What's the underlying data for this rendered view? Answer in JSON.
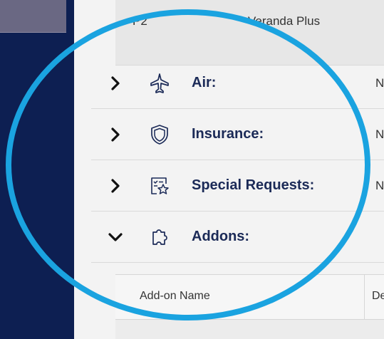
{
  "cabin": {
    "code": "P2",
    "name": "Veranda Plus"
  },
  "sections": [
    {
      "label": "Air:",
      "value": "N",
      "expanded": false,
      "icon": "airplane-icon"
    },
    {
      "label": "Insurance:",
      "value": "N",
      "expanded": false,
      "icon": "shield-icon"
    },
    {
      "label": "Special Requests:",
      "value": "N",
      "expanded": false,
      "icon": "special-request-icon"
    },
    {
      "label": "Addons:",
      "value": "",
      "expanded": true,
      "icon": "puzzle-icon"
    }
  ],
  "addons_table": {
    "columns": [
      "Add-on Name",
      "De"
    ]
  },
  "colors": {
    "sidebar": "#0d1f52",
    "sidebar_item": "#6a6883",
    "label": "#1b2a57",
    "highlight": "#1aa3e0"
  }
}
